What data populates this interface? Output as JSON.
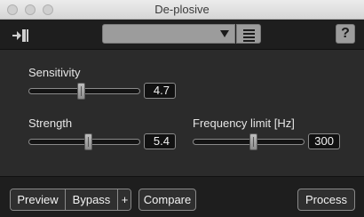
{
  "window": {
    "title": "De-plosive"
  },
  "toolbar": {
    "logo_icon": "plug-arrow-icon",
    "preset_value": "",
    "preset_menu_icon": "list-icon",
    "help_label": "?"
  },
  "controls": {
    "sensitivity": {
      "label": "Sensitivity",
      "value": "4.7",
      "fraction": 0.47
    },
    "strength": {
      "label": "Strength",
      "value": "5.4",
      "fraction": 0.54
    },
    "frequency_limit": {
      "label": "Frequency limit [Hz]",
      "value": "300",
      "fraction": 0.55
    }
  },
  "bottom": {
    "preview_label": "Preview",
    "bypass_label": "Bypass",
    "plus_label": "+",
    "compare_label": "Compare",
    "process_label": "Process"
  },
  "colors": {
    "background": "#2b2b2b",
    "bar": "#1e1e1e",
    "preset_bg": "#9c9c9c"
  }
}
